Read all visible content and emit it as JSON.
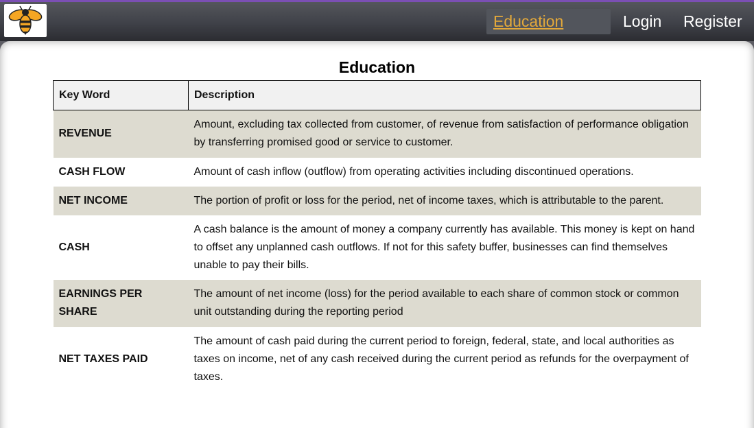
{
  "nav": {
    "logo_icon": "bee-icon",
    "links": [
      "Education Page",
      "Login",
      "Register"
    ]
  },
  "page": {
    "title": "Education"
  },
  "table": {
    "headers": [
      "Key Word",
      "Description"
    ],
    "rows": [
      {
        "keyword": "REVENUE",
        "description": "Amount, excluding tax collected from customer, of revenue from satisfaction of performance obligation by transferring promised good or service to customer."
      },
      {
        "keyword": "CASH FLOW",
        "description": "Amount of cash inflow (outflow) from operating activities including discontinued operations."
      },
      {
        "keyword": "NET INCOME",
        "description": "The portion of profit or loss for the period, net of income taxes, which is attributable to the parent."
      },
      {
        "keyword": "CASH",
        "description": "A cash balance is the amount of money a company currently has available. This money is kept on hand to offset any unplanned cash outflows. If not for this safety buffer, businesses can find themselves unable to pay their bills."
      },
      {
        "keyword": "EARNINGS PER SHARE",
        "description": "The amount of net income (loss) for the period available to each share of common stock or common unit outstanding during the reporting period"
      },
      {
        "keyword": "NET TAXES PAID",
        "description": "The amount of cash paid during the current period to foreign, federal, state, and local authorities as taxes on income, net of any cash received during the current period as refunds for the overpayment of taxes."
      }
    ]
  },
  "colors": {
    "accent": "#e4a93a",
    "shaded_row": "#dddbd0",
    "nav_top_border": "#7b4fb4"
  }
}
